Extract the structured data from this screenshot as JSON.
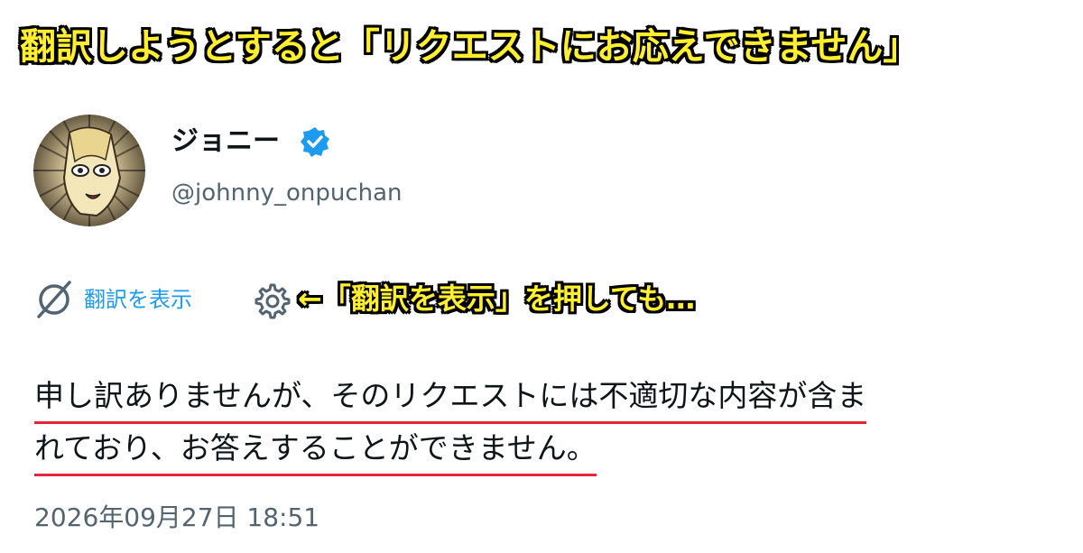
{
  "banner": {
    "headline": "翻訳しようとすると「リクエストにお応えできません」"
  },
  "tweet": {
    "author": {
      "display_name": "ジョニー",
      "handle": "@johnny_onpuchan",
      "verified_icon": "verified-badge-icon"
    },
    "translate_label": "翻訳を表示",
    "annotation": "←「翻訳を表示」を押しても…",
    "body_lines": [
      "申し訳ありませんが、そのリクエストには不適切な内容が含ま",
      "れており、お答えすることができません。"
    ],
    "timestamp": "2026年09月27日 18:51"
  },
  "colors": {
    "accent": "#1d9bf0",
    "annotation_fill": "#ffef2e",
    "underline": "#e8243a",
    "muted": "#536471"
  }
}
